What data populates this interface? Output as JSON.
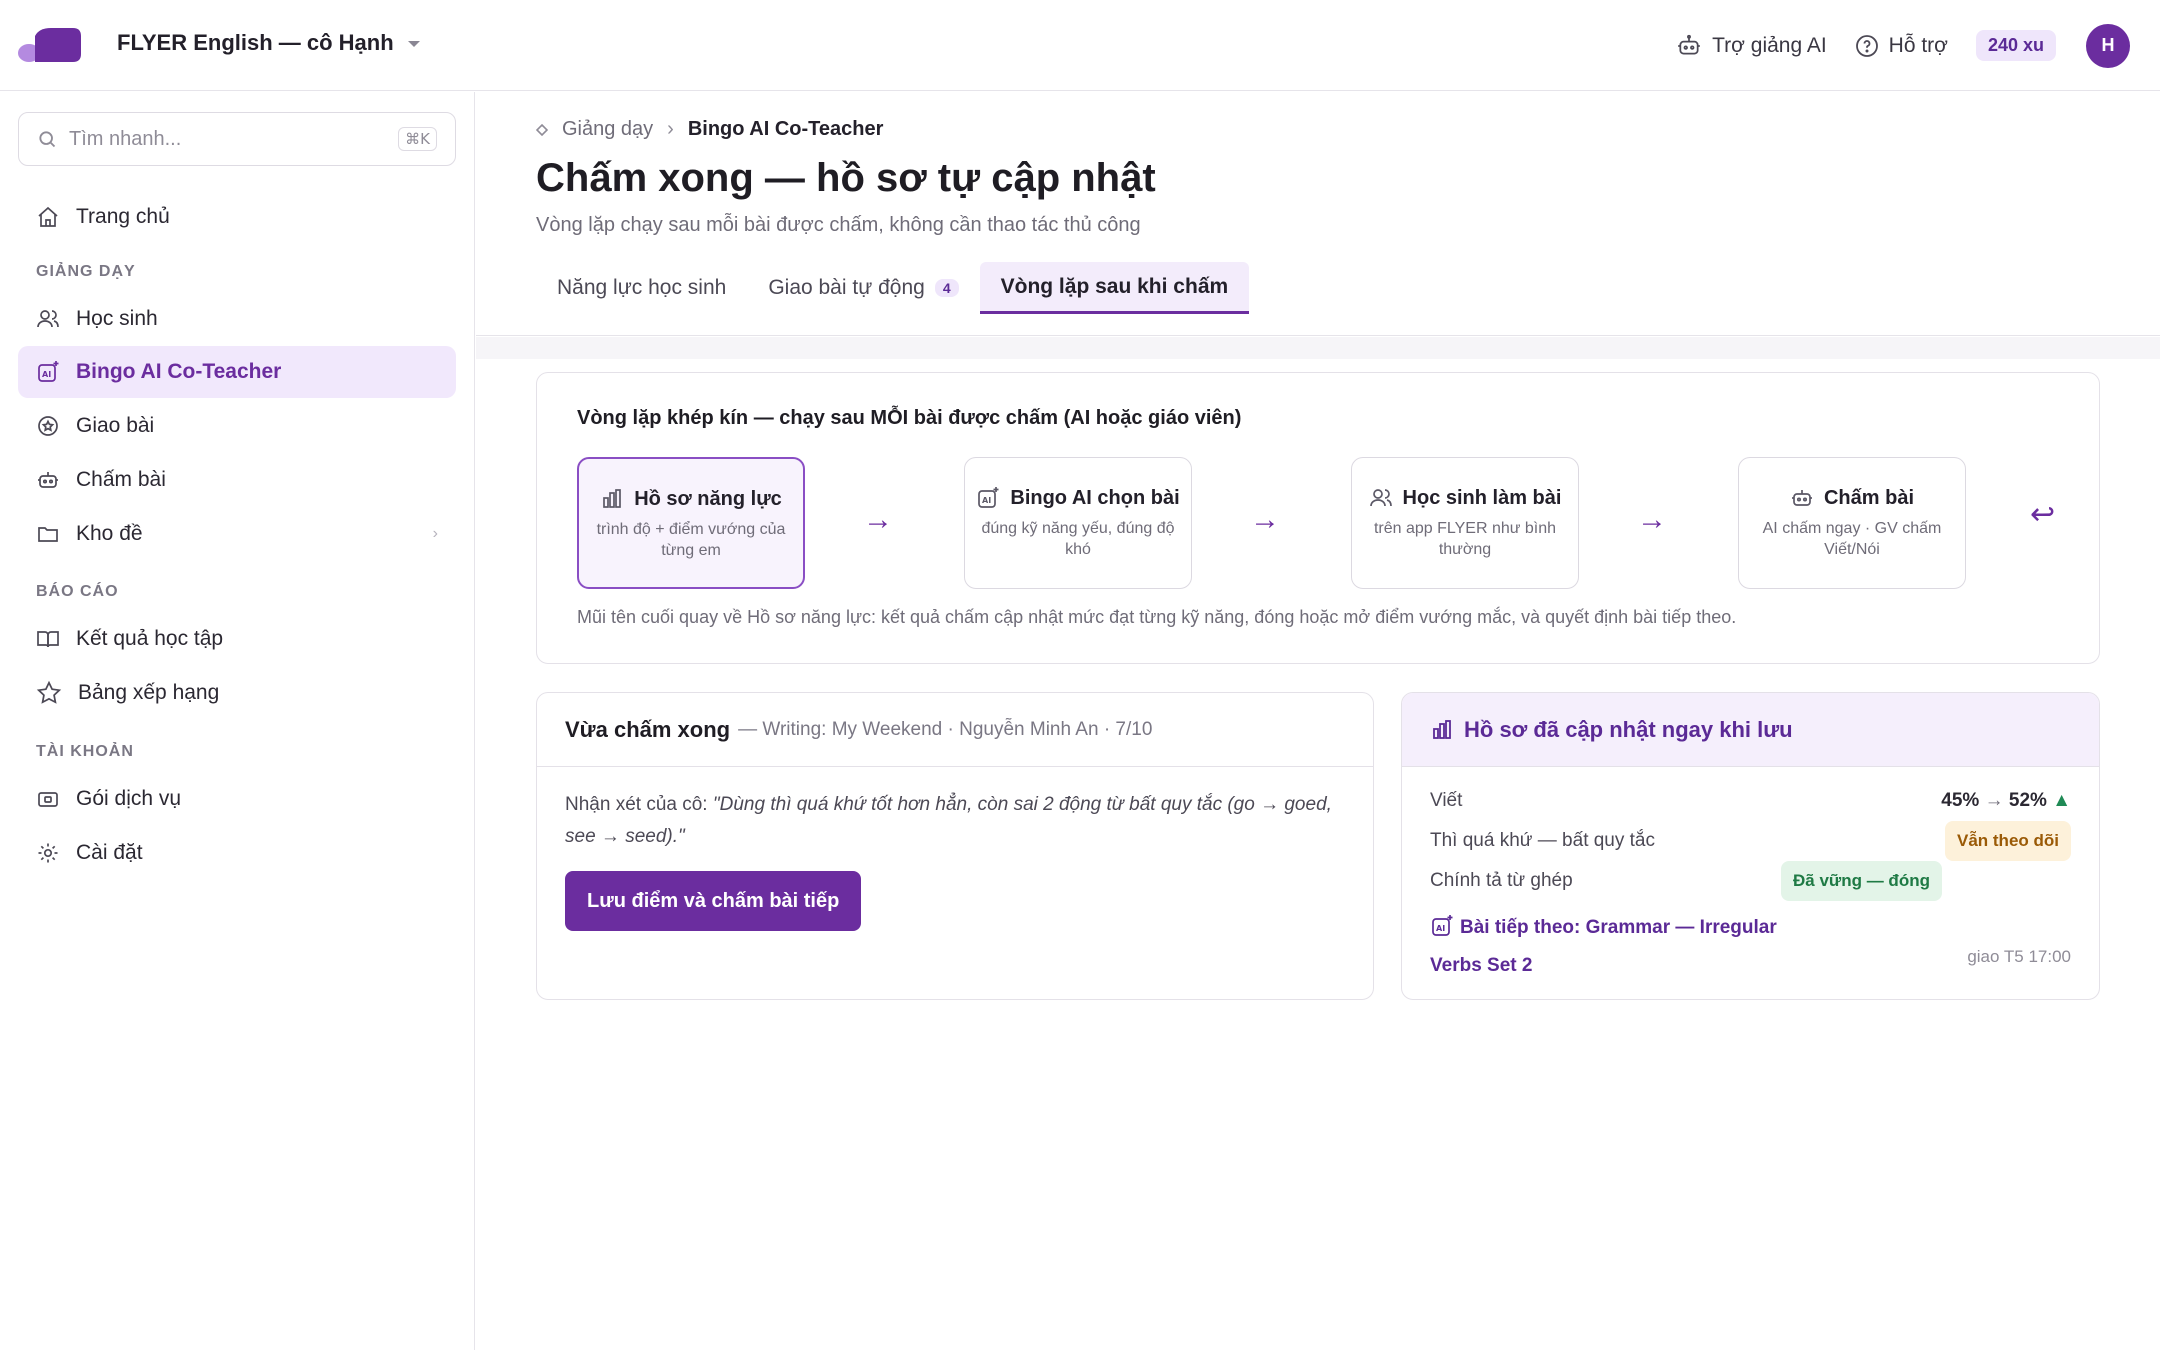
{
  "topbar": {
    "org": "FLYER English — cô Hạnh",
    "ai_assistant": "Trợ giảng AI",
    "support": "Hỗ trợ",
    "coins": "240 xu",
    "avatar_initial": "H"
  },
  "sidebar": {
    "search_placeholder": "Tìm nhanh...",
    "search_shortcut": "⌘K",
    "home": "Trang chủ",
    "section_teaching": "GIẢNG DẠY",
    "students": "Học sinh",
    "coteacher": "Bingo AI Co-Teacher",
    "assign": "Giao bài",
    "grading": "Chấm bài",
    "bank": "Kho đề",
    "section_reports": "BÁO CÁO",
    "results": "Kết quả học tập",
    "ranking": "Bảng xếp hạng",
    "section_account": "TÀI KHOẢN",
    "plans": "Gói dịch vụ",
    "settings": "Cài đặt"
  },
  "page": {
    "breadcrumb_parent": "Giảng dạy",
    "breadcrumb_current": "Bingo AI Co-Teacher",
    "title": "Chấm xong — hồ sơ tự cập nhật",
    "subtitle": "Vòng lặp chạy sau mỗi bài được chấm, không cần thao tác thủ công",
    "tabs": [
      {
        "label": "Năng lực học sinh"
      },
      {
        "label": "Giao bài tự động",
        "badge": "4"
      },
      {
        "label": "Vòng lặp sau khi chấm"
      }
    ]
  },
  "loop": {
    "title": "Vòng lặp khép kín — chạy sau MỖI bài được chấm (AI hoặc giáo viên)",
    "steps": [
      {
        "title": "Hồ sơ năng lực",
        "desc": "trình độ + điểm vướng của từng em"
      },
      {
        "title": "Bingo AI chọn bài",
        "desc": "đúng kỹ năng yếu, đúng độ khó"
      },
      {
        "title": "Học sinh làm bài",
        "desc": "trên app FLYER như bình thường"
      },
      {
        "title": "Chấm bài",
        "desc": "AI chấm ngay · GV chấm Viết/Nói"
      }
    ],
    "arrow": "→",
    "return_arrow": "↩",
    "note": "Mũi tên cuối quay về Hồ sơ năng lực: kết quả chấm cập nhật mức đạt từng kỹ năng, đóng hoặc mở điểm vướng mắc, và quyết định bài tiếp theo."
  },
  "graded": {
    "title": "Vừa chấm xong",
    "meta": "— Writing: My Weekend · Nguyễn Minh An · 7/10",
    "comment_label": "Nhận xét của cô:",
    "comment_quote": "\"Dùng thì quá khứ tốt hơn hẳn, còn sai 2 động từ bất quy tắc (go → goed, see → seed).\"",
    "save_button": "Lưu điểm và chấm bài tiếp"
  },
  "profile": {
    "title": "Hồ sơ đã cập nhật ngay khi lưu",
    "skill_writing": "Viết",
    "writing_from": "45%",
    "writing_to": "52%",
    "delta_arrow": "→",
    "up_mark": "▲",
    "item_past_irregular": "Thì quá khứ — bất quy tắc",
    "status_watch": "Vẫn theo dõi",
    "item_spelling": "Chính tả từ ghép",
    "status_solid": "Đã vững — đóng",
    "next_label": "Bài tiếp theo: Grammar — Irregular Verbs Set 2",
    "due": "giao T5 17:00"
  },
  "colors": {
    "brand": "#6b2d9f",
    "brand_light": "#f1e8fc",
    "up": "#1f8a55",
    "watch_bg": "#fdf1da",
    "solid_bg": "#e3f4e8"
  }
}
